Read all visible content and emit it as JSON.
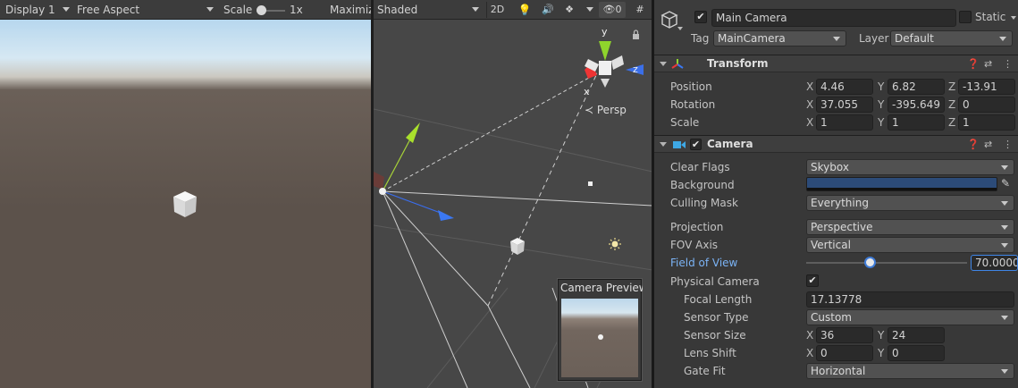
{
  "game_view": {
    "display": "Display 1",
    "aspect": "Free Aspect",
    "scale_label": "Scale",
    "scale_value": "1x",
    "maximize": "Maximiz"
  },
  "scene_view": {
    "draw_mode": "Shaded",
    "mode_2d": "2D",
    "hidden_count": "0",
    "persp_label": "Persp",
    "gizmo_axes": {
      "x": "x",
      "y": "y",
      "z": "z"
    },
    "preview_title": "Camera Preview"
  },
  "inspector": {
    "object_name": "Main Camera",
    "static_label": "Static",
    "tag_label": "Tag",
    "tag_value": "MainCamera",
    "layer_label": "Layer",
    "layer_value": "Default",
    "transform": {
      "title": "Transform",
      "rows": [
        {
          "label": "Position",
          "x": "4.46",
          "y": "6.82",
          "z": "-13.91"
        },
        {
          "label": "Rotation",
          "x": "37.055",
          "y": "-395.649",
          "z": "0"
        },
        {
          "label": "Scale",
          "x": "1",
          "y": "1",
          "z": "1"
        }
      ]
    },
    "camera": {
      "title": "Camera",
      "clear_flags_label": "Clear Flags",
      "clear_flags": "Skybox",
      "background_label": "Background",
      "background_color": "#2c4b78",
      "culling_mask_label": "Culling Mask",
      "culling_mask": "Everything",
      "projection_label": "Projection",
      "projection": "Perspective",
      "fov_axis_label": "FOV Axis",
      "fov_axis": "Vertical",
      "fov_label": "Field of View",
      "fov_value": "70.0000",
      "fov_slider": 0.397,
      "physical_label": "Physical Camera",
      "focal_length_label": "Focal Length",
      "focal_length": "17.13778",
      "sensor_type_label": "Sensor Type",
      "sensor_type": "Custom",
      "sensor_size_label": "Sensor Size",
      "sensor_x": "36",
      "sensor_y": "24",
      "lens_shift_label": "Lens Shift",
      "lens_x": "0",
      "lens_y": "0",
      "gate_fit_label": "Gate Fit",
      "gate_fit": "Horizontal"
    },
    "axis_letters": {
      "x": "X",
      "y": "Y",
      "z": "Z"
    }
  },
  "colors": {
    "accent_blue": "#7bb3f5",
    "x_axis": "#e8373a",
    "y_axis": "#8fd42c",
    "z_axis": "#3a78f2"
  }
}
